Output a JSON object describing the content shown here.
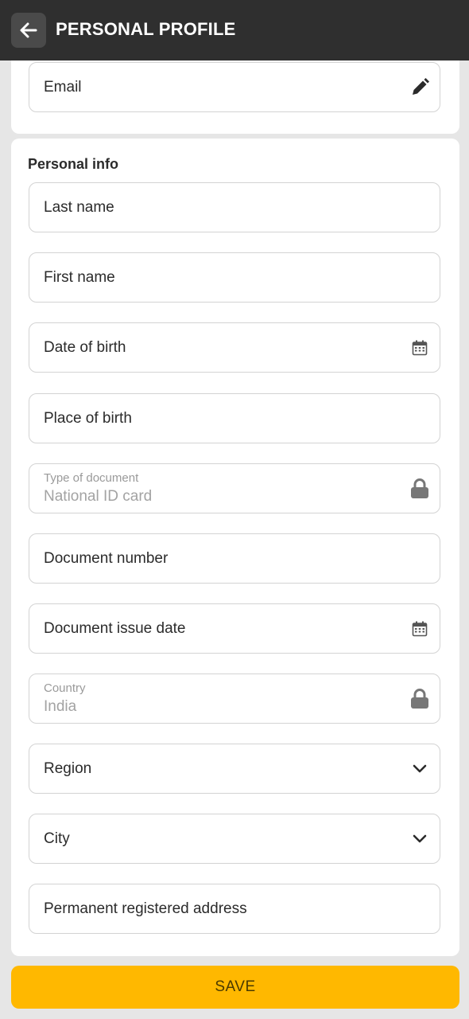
{
  "header": {
    "title": "PERSONAL PROFILE",
    "back_icon": "arrow-left-icon"
  },
  "email_section": {
    "email_label": "Email",
    "edit_icon": "pencil-icon"
  },
  "personal_info": {
    "title": "Personal info",
    "last_name": "Last name",
    "first_name": "First name",
    "date_of_birth": "Date of birth",
    "place_of_birth": "Place of birth",
    "document_type": {
      "label": "Type of document",
      "value": "National ID card"
    },
    "document_number": "Document number",
    "document_issue_date": "Document issue date",
    "country": {
      "label": "Country",
      "value": "India"
    },
    "region": "Region",
    "city": "City",
    "address": "Permanent registered address"
  },
  "actions": {
    "save_label": "SAVE"
  },
  "colors": {
    "accent": "#ffb800",
    "header_bg": "#2f2f2f",
    "page_bg": "#e6e6e6"
  }
}
